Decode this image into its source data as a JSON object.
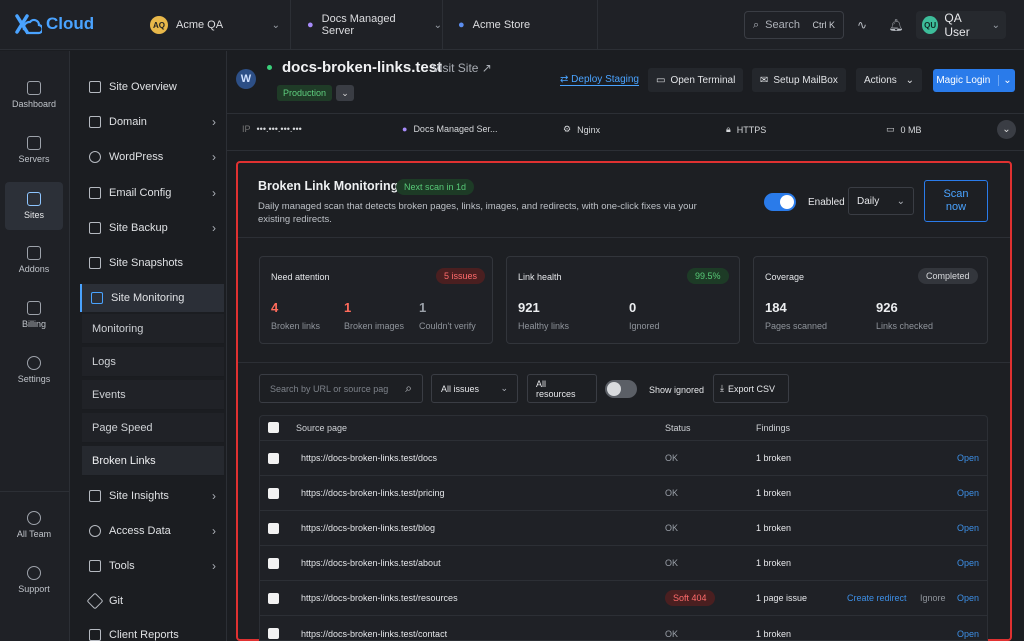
{
  "app": {
    "brand": "Cloud"
  },
  "breadcrumbs": [
    {
      "avatar": "AQ",
      "label": "Acme QA",
      "avatar_color": "#e8b84a"
    },
    {
      "label": "Docs Managed Server"
    },
    {
      "label": "Acme Store"
    }
  ],
  "search": {
    "placeholder": "Search",
    "shortcut": "Ctrl K"
  },
  "user": {
    "initials": "QU",
    "name": "QA User",
    "avatar_color": "#3dbd9a"
  },
  "rail": [
    "Dashboard",
    "Servers",
    "Sites",
    "Addons",
    "Billing",
    "Settings",
    "All Team",
    "Support"
  ],
  "sidenav": {
    "items": [
      {
        "label": "Site Overview"
      },
      {
        "label": "Domain"
      },
      {
        "label": "WordPress"
      },
      {
        "label": "Email Config"
      },
      {
        "label": "Site Backup"
      },
      {
        "label": "Site Snapshots"
      },
      {
        "label": "Site Monitoring"
      },
      {
        "label": "Site Insights"
      },
      {
        "label": "Access Data"
      },
      {
        "label": "Tools"
      },
      {
        "label": "Git"
      },
      {
        "label": "Client Reports"
      }
    ],
    "sub_items": [
      "Monitoring",
      "Logs",
      "Events",
      "Page Speed",
      "Broken Links"
    ]
  },
  "site": {
    "title": "docs-broken-links.test",
    "visit": "Visit Site ↗",
    "env": "Production",
    "buttons": {
      "deploy": "Deploy Staging",
      "terminal": "Open Terminal",
      "mailbox": "Setup MailBox",
      "actions": "Actions",
      "magic": "Magic Login"
    }
  },
  "info": {
    "ip_label": "IP",
    "ip": "•••.•••.•••.•••",
    "server": "Docs Managed Ser...",
    "web": "Nginx",
    "https": "HTTPS",
    "disk": "0 MB"
  },
  "monitor": {
    "title": "Broken Link Monitoring",
    "next_scan": "Next scan in 1d",
    "desc": "Daily managed scan that detects broken pages, links, images, and redirects, with one-click fixes via your existing redirects.",
    "enabled_label": "Enabled",
    "frequency": "Daily",
    "scan_button": "Scan now",
    "cards": {
      "attention": {
        "title": "Need attention",
        "badge": "5 issues",
        "stats": [
          {
            "n": "4",
            "l": "Broken links"
          },
          {
            "n": "1",
            "l": "Broken images"
          },
          {
            "n": "1",
            "l": "Couldn't verify"
          }
        ]
      },
      "health": {
        "title": "Link health",
        "badge": "99.5%",
        "stats": [
          {
            "n": "921",
            "l": "Healthy links"
          },
          {
            "n": "0",
            "l": "Ignored"
          }
        ]
      },
      "coverage": {
        "title": "Coverage",
        "badge": "Completed",
        "stats": [
          {
            "n": "184",
            "l": "Pages scanned"
          },
          {
            "n": "926",
            "l": "Links checked"
          }
        ]
      }
    },
    "filters": {
      "search_placeholder": "Search by URL or source page",
      "issues": "All issues",
      "resources": "All resources",
      "show_ignored": "Show ignored",
      "export": "Export CSV"
    },
    "table": {
      "headers": {
        "source": "Source page",
        "status": "Status",
        "findings": "Findings"
      },
      "rows": [
        {
          "url": "https://docs-broken-links.test/docs",
          "status": "OK",
          "findings": "1 broken",
          "open": "Open"
        },
        {
          "url": "https://docs-broken-links.test/pricing",
          "status": "OK",
          "findings": "1 broken",
          "open": "Open"
        },
        {
          "url": "https://docs-broken-links.test/blog",
          "status": "OK",
          "findings": "1 broken",
          "open": "Open"
        },
        {
          "url": "https://docs-broken-links.test/about",
          "status": "OK",
          "findings": "1 broken",
          "open": "Open"
        },
        {
          "url": "https://docs-broken-links.test/resources",
          "status": "Soft 404",
          "findings": "1 page issue",
          "redirect": "Create redirect",
          "ignore": "Ignore",
          "open": "Open"
        },
        {
          "url": "https://docs-broken-links.test/contact",
          "status": "OK",
          "findings": "1 broken",
          "open": "Open"
        }
      ]
    }
  }
}
